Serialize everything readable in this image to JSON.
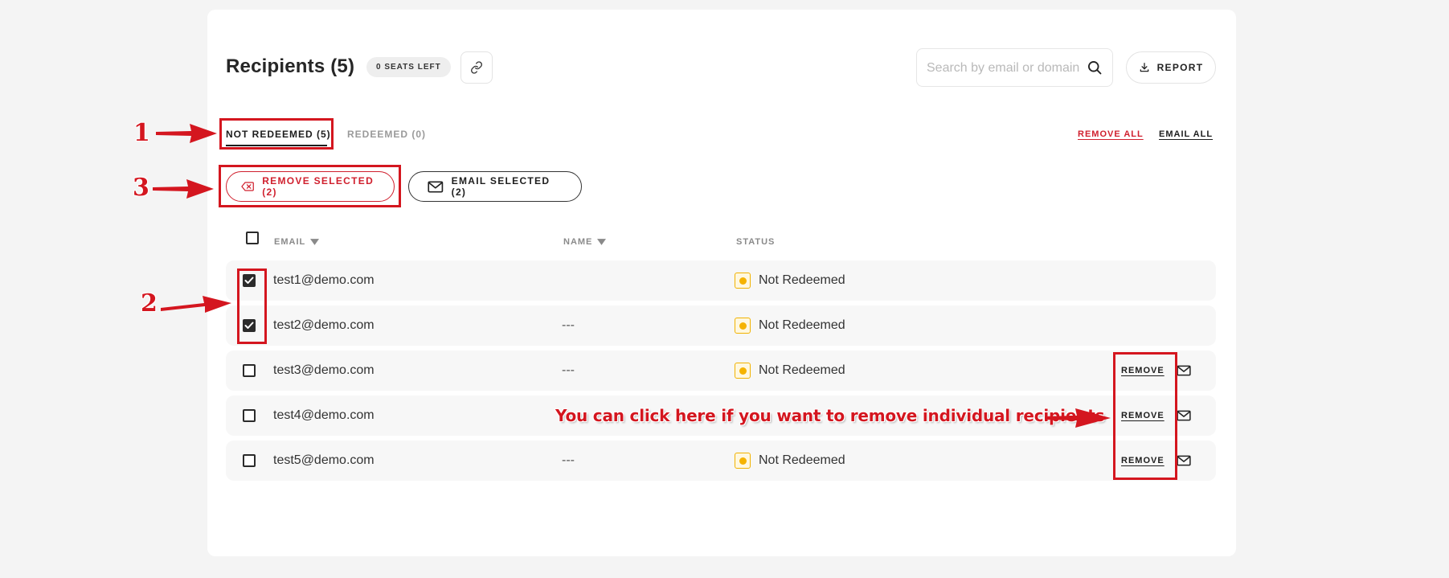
{
  "header": {
    "title": "Recipients (5)",
    "seats_badge": "0 SEATS LEFT",
    "search_placeholder": "Search by email or domain",
    "report_label": "REPORT"
  },
  "tabs": [
    {
      "label": "NOT REDEEMED (5)",
      "active": true
    },
    {
      "label": "REDEEMED (0)",
      "active": false
    }
  ],
  "bulk_links": {
    "remove_all": "REMOVE ALL",
    "email_all": "EMAIL ALL"
  },
  "bulk_actions": {
    "remove_selected": "REMOVE SELECTED (2)",
    "email_selected": "EMAIL SELECTED (2)"
  },
  "table": {
    "columns": [
      "EMAIL",
      "NAME",
      "STATUS"
    ],
    "rows": [
      {
        "email": "test1@demo.com",
        "name": "",
        "status": "Not Redeemed",
        "checked": true,
        "remove": "",
        "show_actions": false
      },
      {
        "email": "test2@demo.com",
        "name": "---",
        "status": "Not Redeemed",
        "checked": true,
        "remove": "",
        "show_actions": false
      },
      {
        "email": "test3@demo.com",
        "name": "---",
        "status": "Not Redeemed",
        "checked": false,
        "remove": "REMOVE",
        "show_actions": true
      },
      {
        "email": "test4@demo.com",
        "name": "",
        "status": "",
        "checked": false,
        "remove": "REMOVE",
        "show_actions": true
      },
      {
        "email": "test5@demo.com",
        "name": "---",
        "status": "Not Redeemed",
        "checked": false,
        "remove": "REMOVE",
        "show_actions": true
      }
    ]
  },
  "annotations": {
    "num1": "1",
    "num2": "2",
    "num3": "3",
    "note": "You can click here if you want to remove individual recipients"
  },
  "colors": {
    "accent_red": "#d0202e",
    "annotation_red": "#d4161f",
    "status_yellow": "#f5b300"
  }
}
